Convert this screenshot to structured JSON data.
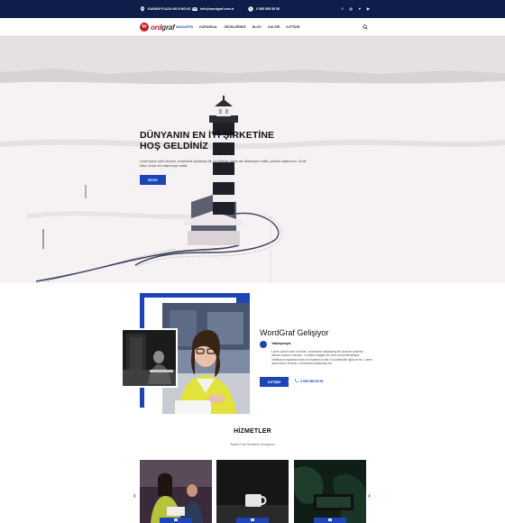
{
  "topbar": {
    "address": "KARAM PLAZA NO:9 NO:63",
    "email": "info@wordgraf.com.tr",
    "phone": "0 555 555 55 55",
    "social": [
      "facebook-icon",
      "instagram-icon",
      "twitter-icon",
      "youtube-icon"
    ]
  },
  "nav": {
    "logo_mark": "W",
    "logo_text_a": "ord",
    "logo_text_b": "graf",
    "items": [
      "ANASAYFA",
      "KURUMSAL",
      "ÜRÜNLERİMİZ",
      "BLOG",
      "GALERİ",
      "İLETİŞİM"
    ],
    "active_index": 0
  },
  "hero": {
    "title_line1": "DÜNYANIN EN İYİ ŞİRKETİNE",
    "title_line2": "HOŞ GELDİNİZ",
    "text": "Lorem ipsum dolor sit amet, consectetur adipiscing elit. Ut elit tellus, luctus nec ullamcorper mattis, pulvinar dapibus leo. Ut elit tellus, luctus nec ullamcorper mattis.",
    "button": "DETAY"
  },
  "about": {
    "heading": "WordGraf Gelişiyor",
    "feature_title": "Yaklaşımıyla",
    "feature_text": "Lorem ipsum dolor sit amet, consectetur adipiscing elit. Aenean placerat ultrices massa in dictum. Curabitur sagittis leo risus sed pellentesque. Vestibulum egestas turpis non dapibus mollis. Ut sollicitudin ligula et leo. Lorem ipsum dolor sit amet, consectetur adipiscing elit.",
    "button": "İLETİŞİM",
    "phone": "0 555 555 55 55"
  },
  "services": {
    "title": "HİZMETLER",
    "subtitle": "Sizlere Özel Hizmetler Sunuyoruz"
  },
  "colors": {
    "accent": "#1c45b8",
    "topbar": "#0f1d4a",
    "logo_red": "#c21d24"
  }
}
